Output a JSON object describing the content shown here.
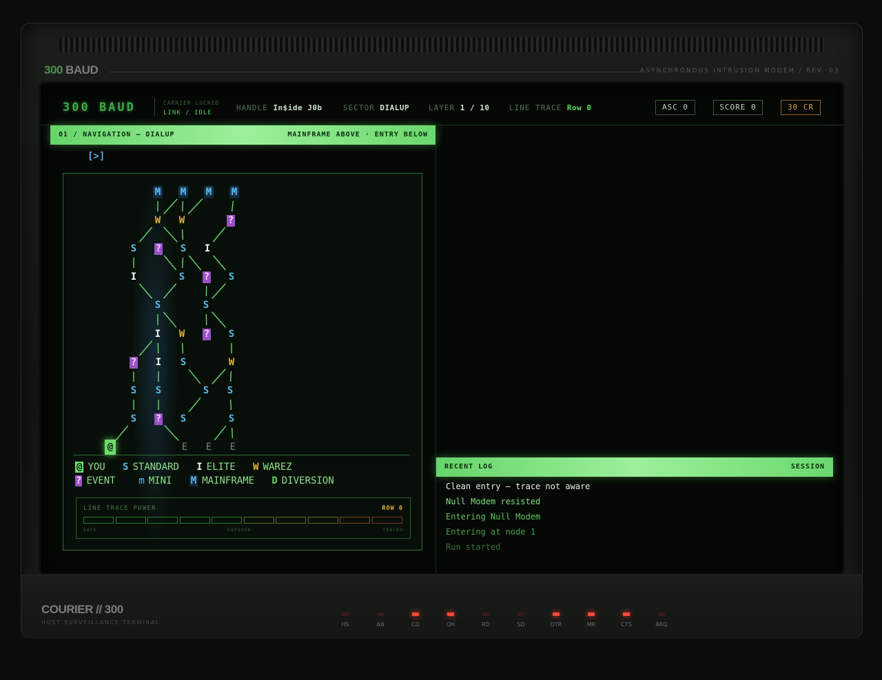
{
  "device": {
    "brand_num": "300",
    "brand_word": "BAUD",
    "revision": "ASYNCHRONOUS INTRUSION MODEM / REV. 03",
    "footer_brand": "COURIER // 300",
    "footer_sub": "HOST SURVEILLANCE TERMINAL"
  },
  "status_bar": {
    "logo": "300 BAUD",
    "carrier_label": "CARRIER LOCKED",
    "carrier_state": "LINK / IDLE",
    "handle_label": "HANDLE",
    "handle_value": "In$ide J0b",
    "sector_label": "SECTOR",
    "sector_value": "DIALUP",
    "layer_label": "LAYER",
    "layer_value": "1 / 10",
    "trace_label": "LINE TRACE",
    "trace_value": "Row 0",
    "asc": "ASC 0",
    "score": "SCORE 0",
    "credits": "30 CR"
  },
  "nav_panel": {
    "title": "01 / NAVIGATION — DIALUP",
    "hint": "MAINFRAME ABOVE · ENTRY BELOW",
    "prompt": "[>]"
  },
  "map": {
    "nodes": [
      {
        "t": "M",
        "label": "M"
      },
      {
        "t": "M",
        "label": "M"
      },
      {
        "t": "M",
        "label": "M"
      },
      {
        "t": "M",
        "label": "M"
      },
      {
        "t": "W",
        "label": "W"
      },
      {
        "t": "W",
        "label": "W"
      },
      {
        "t": "Q",
        "label": "?"
      },
      {
        "t": "S",
        "label": "S"
      },
      {
        "t": "Q",
        "label": "?"
      },
      {
        "t": "S",
        "label": "S"
      },
      {
        "t": "I",
        "label": "I"
      },
      {
        "t": "I",
        "label": "I"
      },
      {
        "t": "S",
        "label": "S"
      },
      {
        "t": "Q",
        "label": "?"
      },
      {
        "t": "S",
        "label": "S"
      },
      {
        "t": "S",
        "label": "S"
      },
      {
        "t": "S",
        "label": "S"
      },
      {
        "t": "I",
        "label": "I"
      },
      {
        "t": "W",
        "label": "W"
      },
      {
        "t": "Q",
        "label": "?"
      },
      {
        "t": "S",
        "label": "S"
      },
      {
        "t": "Q",
        "label": "?"
      },
      {
        "t": "I",
        "label": "I"
      },
      {
        "t": "S",
        "label": "S"
      },
      {
        "t": "W",
        "label": "W"
      },
      {
        "t": "S",
        "label": "S"
      },
      {
        "t": "S",
        "label": "S"
      },
      {
        "t": "S",
        "label": "S"
      },
      {
        "t": "S",
        "label": "S"
      },
      {
        "t": "S",
        "label": "S"
      },
      {
        "t": "Q",
        "label": "?"
      },
      {
        "t": "S",
        "label": "S"
      },
      {
        "t": "S",
        "label": "S"
      },
      {
        "t": "Y",
        "label": "@"
      },
      {
        "t": "E",
        "label": "E"
      },
      {
        "t": "E",
        "label": "E"
      },
      {
        "t": "E",
        "label": "E"
      }
    ]
  },
  "legend": {
    "you_sym": "@",
    "you": "YOU",
    "standard_sym": "S",
    "standard": "STANDARD",
    "elite_sym": "I",
    "elite": "ELITE",
    "warez_sym": "W",
    "warez": "WAREZ",
    "event_sym": "?",
    "event": "EVENT",
    "mini_sym": "m",
    "mini": "MINI",
    "mainframe_sym": "M",
    "mainframe": "MAINFRAME",
    "diversion_sym": "D",
    "diversion": "DIVERSION"
  },
  "trace_power": {
    "title": "LINE TRACE POWER",
    "row": "ROW 0",
    "segments": 10,
    "filled": 0,
    "scale_safe": "SAFE",
    "scale_exposed": "EXPOSED",
    "scale_traced": "TRACED"
  },
  "log": {
    "title": "RECENT LOG",
    "tag": "SESSION",
    "entries": [
      {
        "text": "Clean entry — trace not aware",
        "color": "#e6f2e6"
      },
      {
        "text": "Null Modem resisted",
        "color": "#7ee07e"
      },
      {
        "text": "Entering Null Modem",
        "color": "#5ec45e"
      },
      {
        "text": "Entering at node 1",
        "color": "#4a9e4a"
      },
      {
        "text": "Run started",
        "color": "#3a6e3a"
      }
    ]
  },
  "leds": [
    {
      "label": "HS",
      "on": false
    },
    {
      "label": "AA",
      "on": false
    },
    {
      "label": "CD",
      "on": true
    },
    {
      "label": "OH",
      "on": true
    },
    {
      "label": "RD",
      "on": false
    },
    {
      "label": "SD",
      "on": false
    },
    {
      "label": "DTR",
      "on": true
    },
    {
      "label": "MR",
      "on": true
    },
    {
      "label": "CTS",
      "on": true
    },
    {
      "label": "ARQ",
      "on": false
    }
  ],
  "colors": {
    "phosphor": "#66d46b",
    "accent_blue": "#5bb8e6",
    "warez": "#e2b23c",
    "event": "#9a52c4",
    "credits": "#d8a44a",
    "led_on": "#ff4a3a"
  }
}
